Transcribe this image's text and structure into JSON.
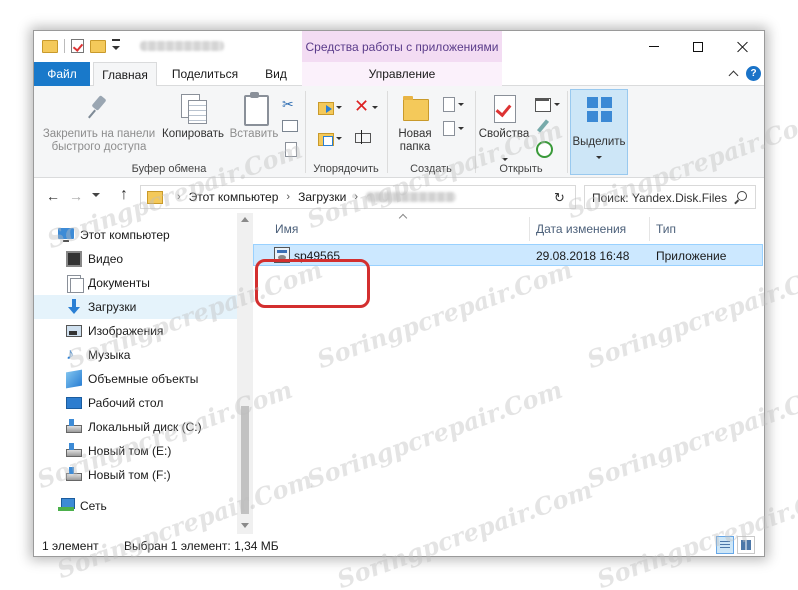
{
  "window": {
    "contextual_tab_title": "Средства работы с приложениями",
    "controls": {
      "minimize_icon": "minimize-icon",
      "maximize_icon": "maximize-icon",
      "close_icon": "close-icon"
    }
  },
  "ribbon_tabs": {
    "file": "Файл",
    "home": "Главная",
    "share": "Поделиться",
    "view": "Вид",
    "manage": "Управление",
    "help": "?"
  },
  "ribbon": {
    "clipboard": {
      "pin": "Закрепить на панели быстрого доступа",
      "copy": "Копировать",
      "paste": "Вставить",
      "label": "Буфер обмена"
    },
    "organize": {
      "label": "Упорядочить"
    },
    "new": {
      "new_folder": "Новая папка",
      "label": "Создать"
    },
    "open": {
      "properties": "Свойства",
      "label": "Открыть"
    },
    "select": {
      "select": "Выделить"
    }
  },
  "address": {
    "crumbs": [
      "Этот компьютер",
      "Загрузки"
    ],
    "search_placeholder": "Поиск: Yandex.Disk.Files"
  },
  "nav": {
    "items": [
      {
        "label": "Этот компьютер",
        "icon": "computer-icon"
      },
      {
        "label": "Видео",
        "icon": "video-icon"
      },
      {
        "label": "Документы",
        "icon": "documents-icon"
      },
      {
        "label": "Загрузки",
        "icon": "downloads-icon",
        "selected": true
      },
      {
        "label": "Изображения",
        "icon": "pictures-icon"
      },
      {
        "label": "Музыка",
        "icon": "music-icon"
      },
      {
        "label": "Объемные объекты",
        "icon": "3d-objects-icon"
      },
      {
        "label": "Рабочий стол",
        "icon": "desktop-icon"
      },
      {
        "label": "Локальный диск (C:)",
        "icon": "drive-icon"
      },
      {
        "label": "Новый том (E:)",
        "icon": "drive-icon"
      },
      {
        "label": "Новый том (F:)",
        "icon": "drive-icon"
      },
      {
        "label": "Сеть",
        "icon": "network-icon"
      }
    ]
  },
  "files": {
    "columns": {
      "name": "Имя",
      "date": "Дата изменения",
      "type": "Тип"
    },
    "rows": [
      {
        "name": "sp49565",
        "date": "29.08.2018 16:48",
        "type": "Приложение"
      }
    ]
  },
  "status": {
    "count": "1 элемент",
    "selection": "Выбран 1 элемент: 1,34 МБ"
  },
  "watermark": "Soringpcrepair.Com"
}
